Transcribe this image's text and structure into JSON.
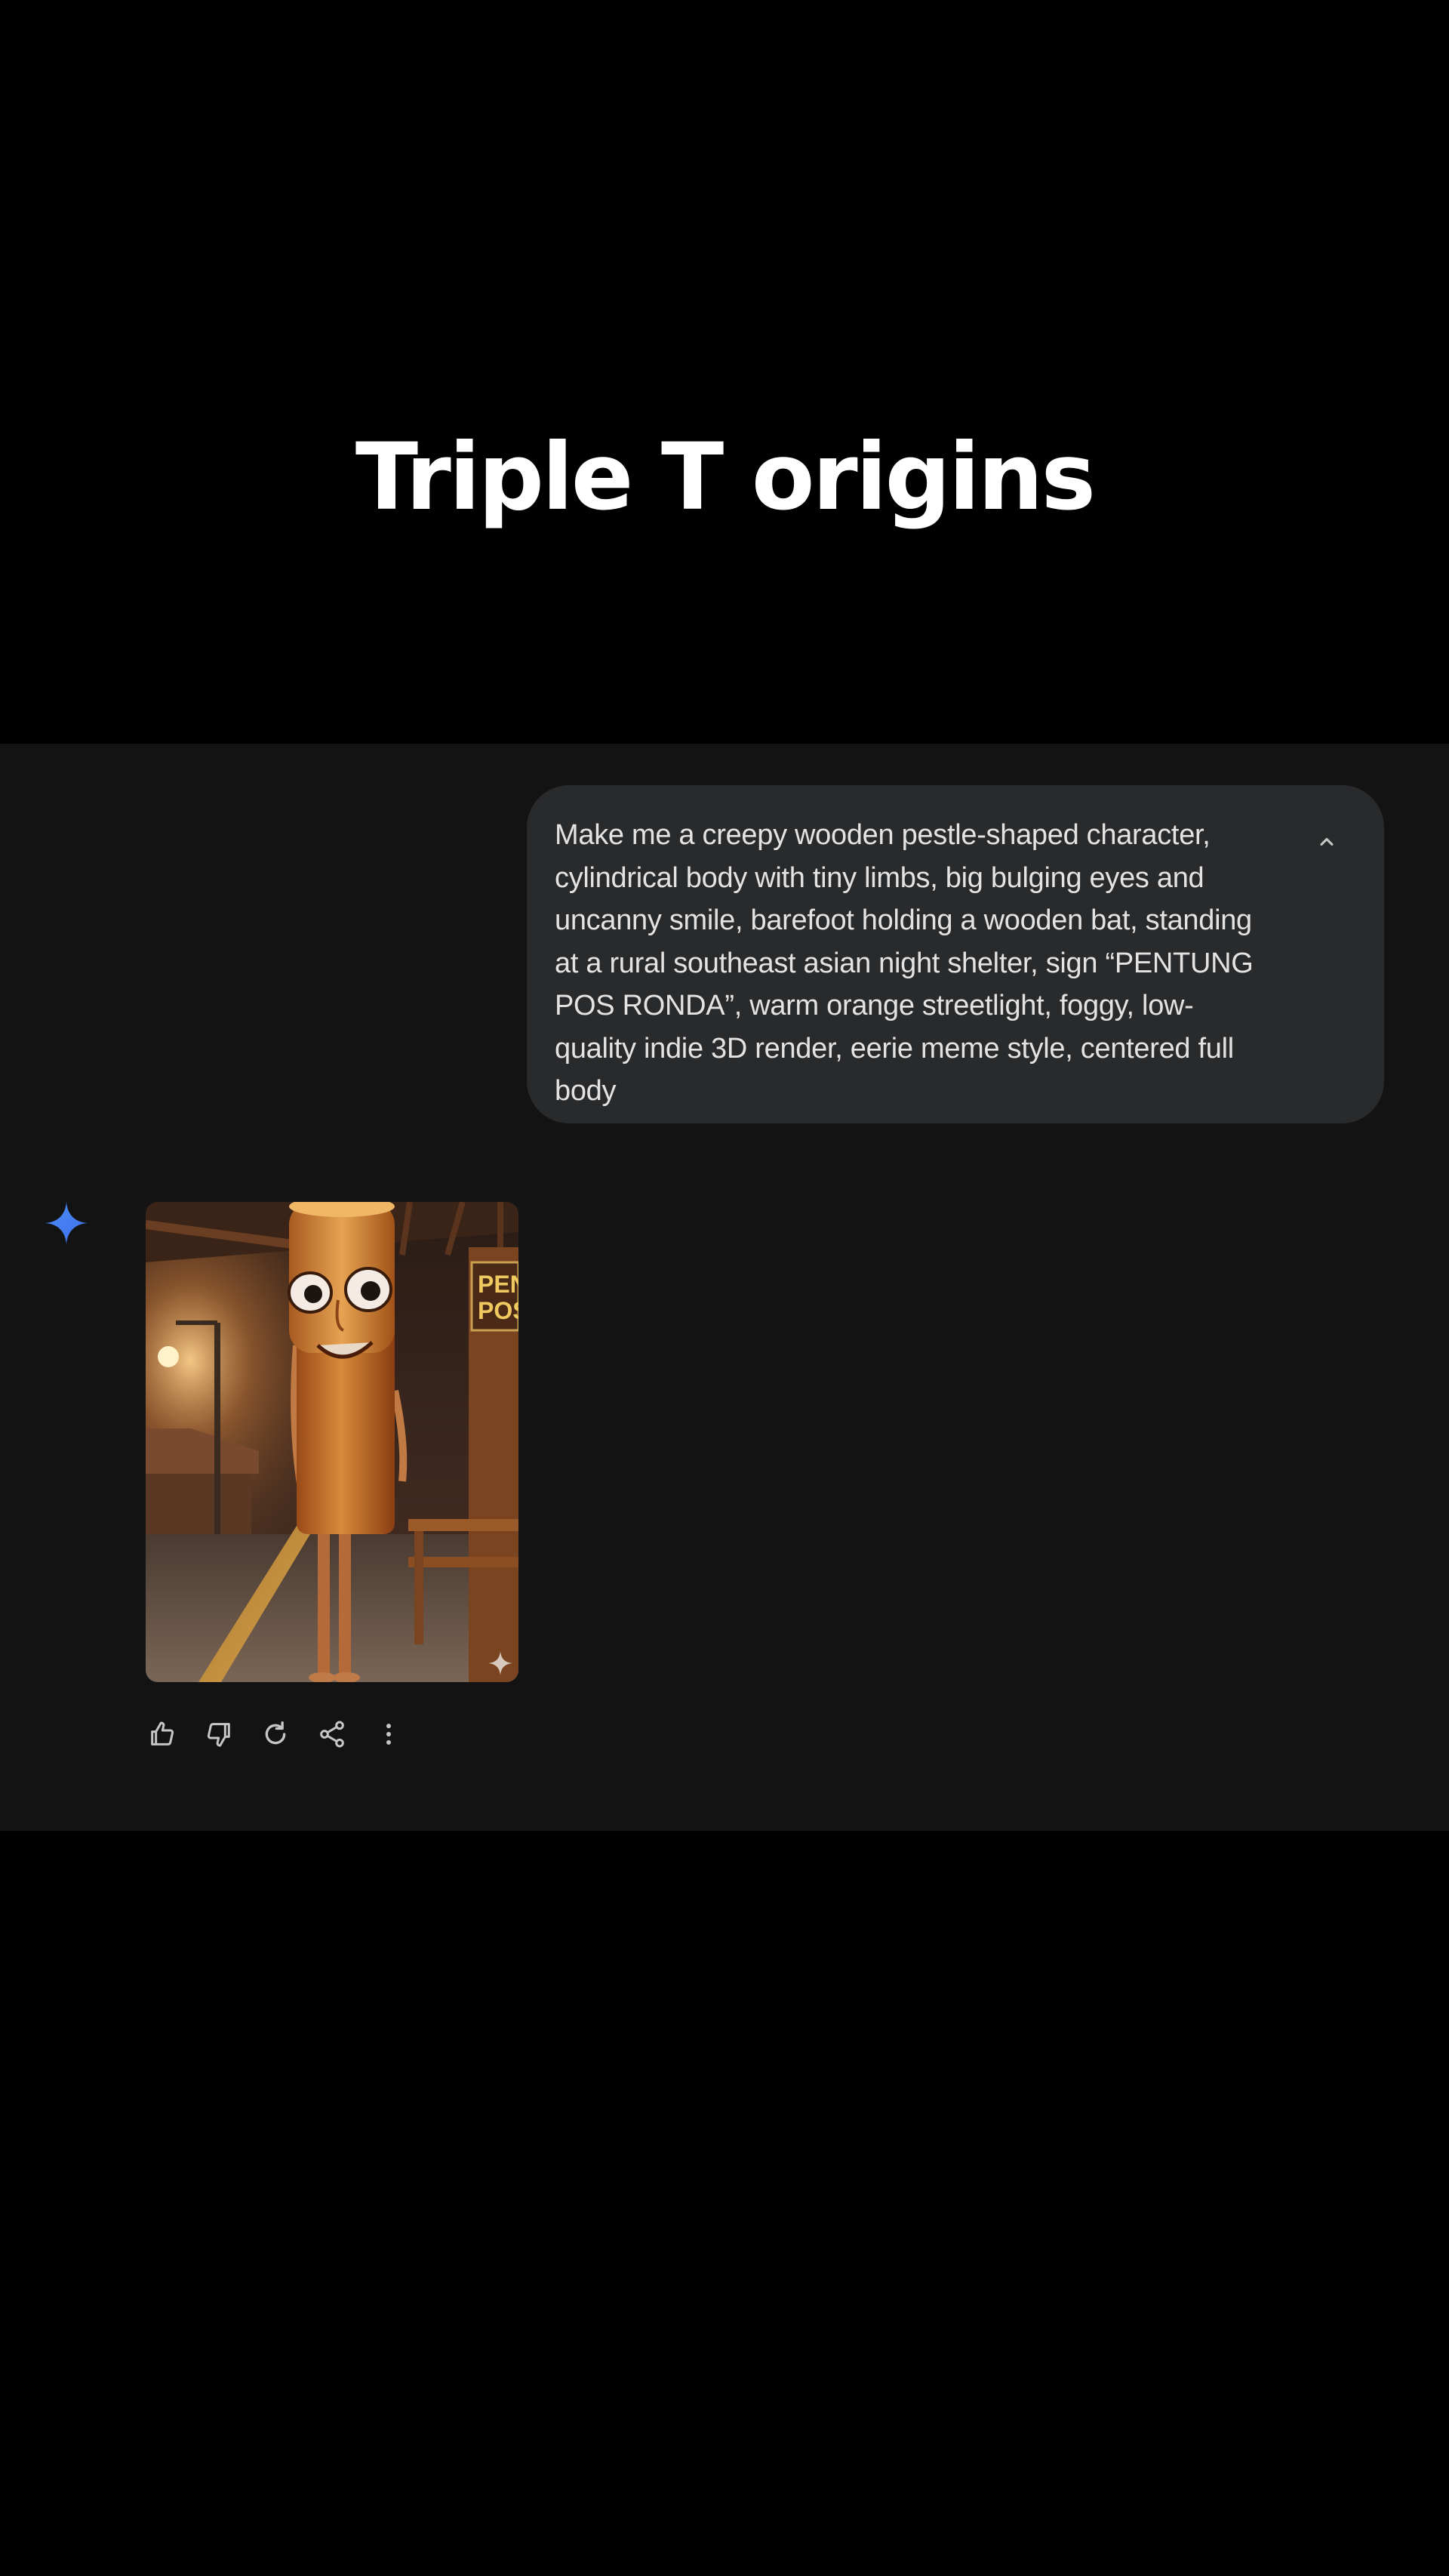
{
  "overlay": {
    "title": "Triple T origins"
  },
  "chat": {
    "user_prompt": "Make me a creepy wooden pestle-shaped character, cylindrical body with tiny limbs, big bulging eyes and uncanny smile, barefoot holding a wooden bat, standing at a rural southeast asian night shelter, sign “PENTUNG POS RONDA”, warm orange streetlight, foggy, low-quality indie 3D render, eerie meme style, centered full body",
    "collapse_icon": "chevron-up-icon",
    "assistant_icon": "gemini-sparkle-icon",
    "generated_image": {
      "sign_text_line1": "PEN",
      "sign_text_line2": "POS"
    },
    "actions": [
      {
        "name": "thumbs-up-icon"
      },
      {
        "name": "thumbs-down-icon"
      },
      {
        "name": "regenerate-icon"
      },
      {
        "name": "share-icon"
      },
      {
        "name": "more-options-icon"
      }
    ]
  },
  "colors": {
    "page_background": "#000000",
    "chat_background": "#131314",
    "bubble_background": "#282a2c",
    "text": "#e3e3e3",
    "gemini_blue": "#4a8df8"
  }
}
